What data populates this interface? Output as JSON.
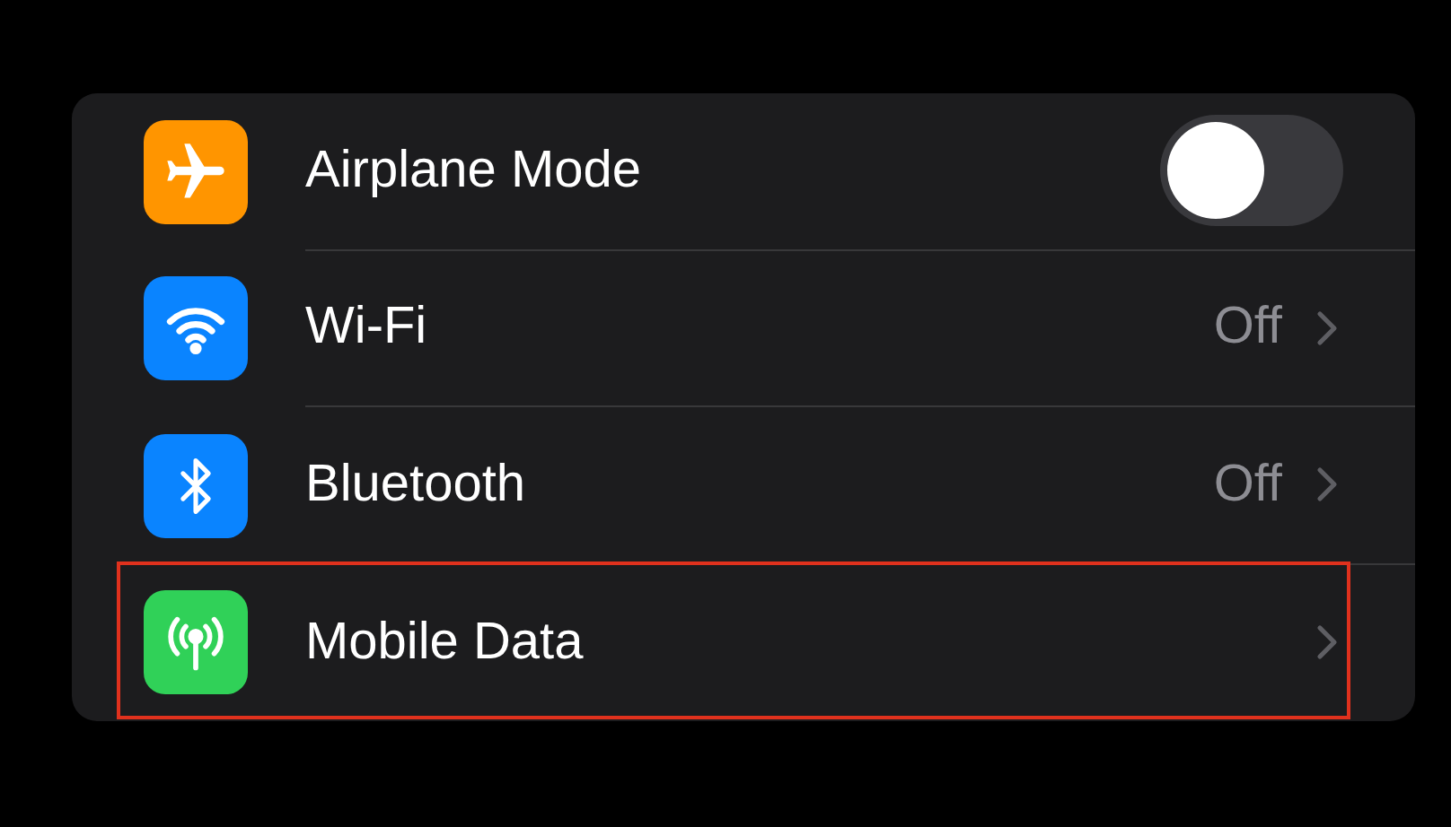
{
  "settings": [
    {
      "label": "Airplane Mode",
      "kind": "toggle",
      "on": false,
      "highlighted": false
    },
    {
      "label": "Wi-Fi",
      "kind": "value",
      "value": "Off",
      "highlighted": false
    },
    {
      "label": "Bluetooth",
      "kind": "value",
      "value": "Off",
      "highlighted": false
    },
    {
      "label": "Mobile Data",
      "kind": "link",
      "highlighted": true
    }
  ]
}
